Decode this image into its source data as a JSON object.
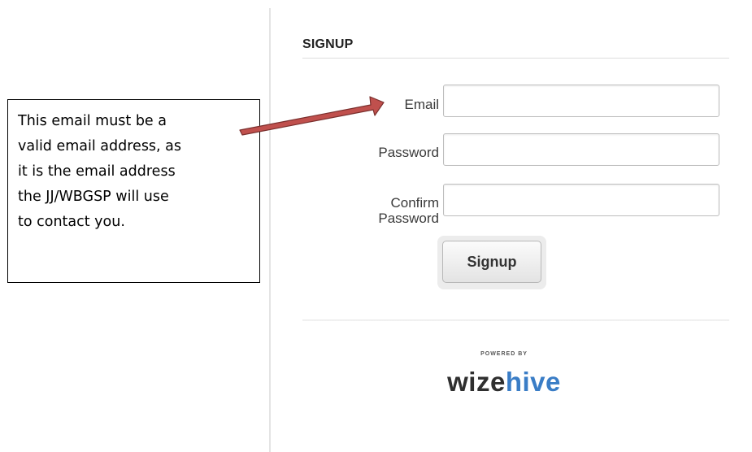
{
  "signup": {
    "title": "SIGNUP",
    "email_label": "Email",
    "email_value": "",
    "password_label": "Password",
    "password_value": "",
    "confirm_label_line1": "Confirm",
    "confirm_label_line2": "Password",
    "confirm_value": "",
    "button_label": "Signup"
  },
  "footer": {
    "powered_by": "POWERED BY",
    "logo_part1": "wize",
    "logo_part2": "hive"
  },
  "annotation": {
    "lines": [
      "This email must be a",
      "valid email address, as",
      "it is the email address",
      "the JJ/WBGSP will use",
      "to contact you."
    ],
    "arrow_color": "#c0504d",
    "arrow_border": "#7a2f2d"
  },
  "colors": {
    "logo_dark": "#2f2f2f",
    "logo_blue": "#3a7dc6"
  }
}
